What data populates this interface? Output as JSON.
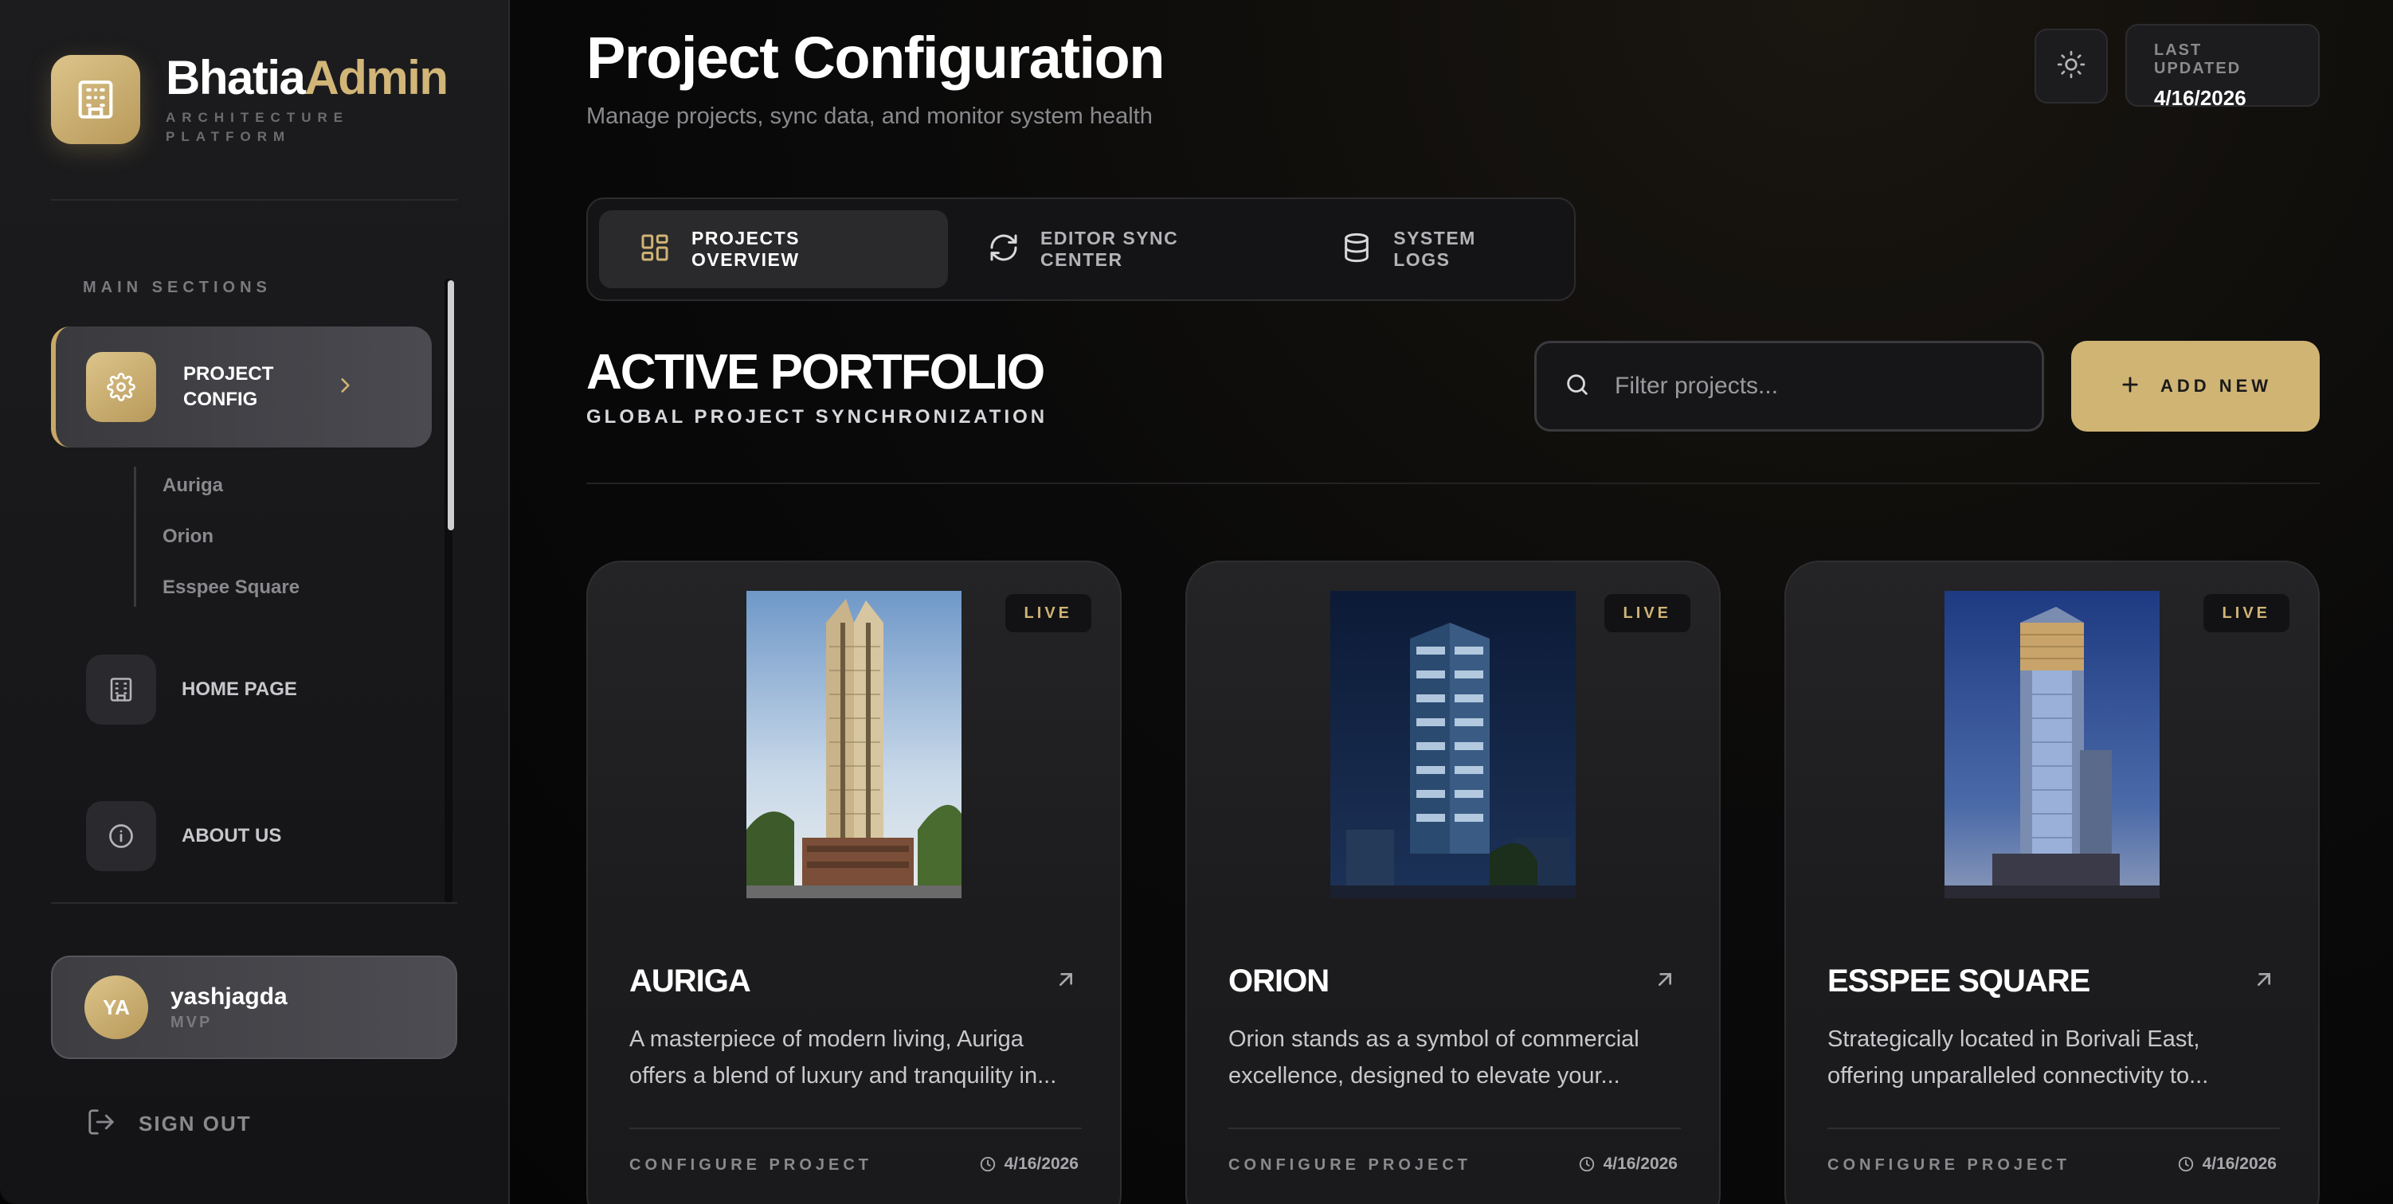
{
  "brand": {
    "name_part1": "Bhatia",
    "name_part2": "Admin",
    "subtitle": "ARCHITECTURE PLATFORM"
  },
  "sidebar": {
    "section_label": "MAIN SECTIONS",
    "active_item": {
      "label": "PROJECT CONFIG",
      "icon": "gear-icon"
    },
    "sub_items": [
      "Auriga",
      "Orion",
      "Esspee Square"
    ],
    "items": [
      {
        "label": "HOME PAGE",
        "icon": "building-icon"
      },
      {
        "label": "ABOUT US",
        "icon": "info-icon"
      }
    ]
  },
  "user": {
    "initials": "YA",
    "name": "yashjagda",
    "role": "MVP"
  },
  "signout": {
    "label": "SIGN OUT"
  },
  "header": {
    "title": "Project Configuration",
    "subtitle": "Manage projects, sync data, and monitor system health",
    "last_updated_label": "LAST UPDATED",
    "last_updated_value": "4/16/2026"
  },
  "tabs": [
    {
      "label": "PROJECTS OVERVIEW",
      "icon": "grid-icon",
      "active": true
    },
    {
      "label": "EDITOR SYNC CENTER",
      "icon": "sync-icon",
      "active": false
    },
    {
      "label": "SYSTEM LOGS",
      "icon": "database-icon",
      "active": false
    }
  ],
  "portfolio": {
    "title": "ACTIVE PORTFOLIO",
    "subtitle": "GLOBAL PROJECT SYNCHRONIZATION"
  },
  "search": {
    "placeholder": "Filter projects...",
    "value": ""
  },
  "add_button": {
    "label": "ADD NEW"
  },
  "projects": [
    {
      "name": "AURIGA",
      "status": "LIVE",
      "description_line1": "A masterpiece of modern living, Auriga",
      "description_line2": "offers a blend of luxury and tranquility in...",
      "action": "CONFIGURE PROJECT",
      "date": "4/16/2026"
    },
    {
      "name": "ORION",
      "status": "LIVE",
      "description_line1": "Orion stands as a symbol of commercial",
      "description_line2": "excellence, designed to elevate your...",
      "action": "CONFIGURE PROJECT",
      "date": "4/16/2026"
    },
    {
      "name": "ESSPEE SQUARE",
      "status": "LIVE",
      "description_line1": "Strategically located in Borivali East,",
      "description_line2": "offering unparalleled connectivity to...",
      "action": "CONFIGURE PROJECT",
      "date": "4/16/2026"
    }
  ],
  "colors": {
    "accent": "#d0b474",
    "background": "#050505",
    "sidebar": "#1c1c1e"
  }
}
